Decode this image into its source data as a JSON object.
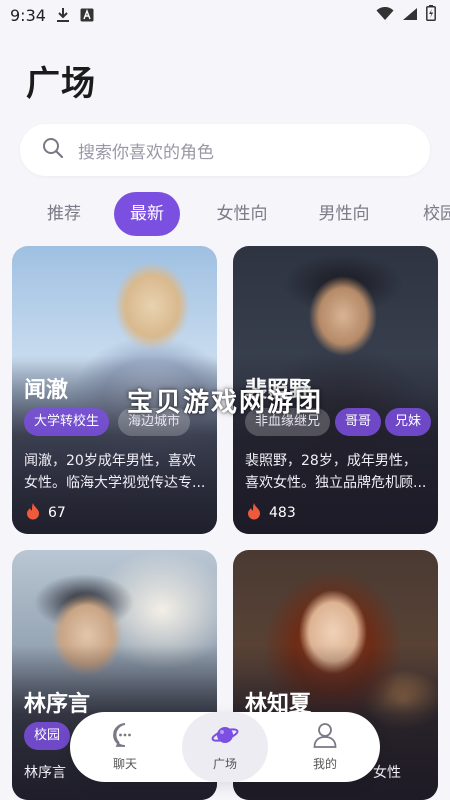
{
  "status_bar": {
    "time": "9:34"
  },
  "page": {
    "title": "广场"
  },
  "search": {
    "placeholder": "搜索你喜欢的角色"
  },
  "tabs": [
    {
      "label": "推荐"
    },
    {
      "label": "最新",
      "active": true
    },
    {
      "label": "女性向"
    },
    {
      "label": "男性向"
    },
    {
      "label": "校园"
    }
  ],
  "cards": [
    {
      "name": "闻澈",
      "tags": [
        "大学转校生",
        "海边城市"
      ],
      "desc": "闻澈，20岁成年男性，喜欢女性。临海大学视觉传达专...",
      "likes": "67"
    },
    {
      "name": "裴照野",
      "tags": [
        "非血缘继兄",
        "哥哥",
        "兄妹"
      ],
      "desc": "裴照野，28岁，成年男性，喜欢女性。独立品牌危机顾...",
      "likes": "483"
    },
    {
      "name": "林序言",
      "tags": [
        "校园"
      ],
      "desc": "林序言",
      "likes": ""
    },
    {
      "name": "林知夏",
      "tags": [
        ""
      ],
      "desc": "女性",
      "likes": ""
    }
  ],
  "watermark": "宝贝游戏网游团",
  "bottom_nav": [
    {
      "label": "聊天",
      "icon": "chat-bubble-icon"
    },
    {
      "label": "广场",
      "icon": "planet-icon",
      "active": true
    },
    {
      "label": "我的",
      "icon": "user-icon"
    }
  ],
  "colors": {
    "accent": "#7b4fe0",
    "background": "#f6f5fa"
  }
}
